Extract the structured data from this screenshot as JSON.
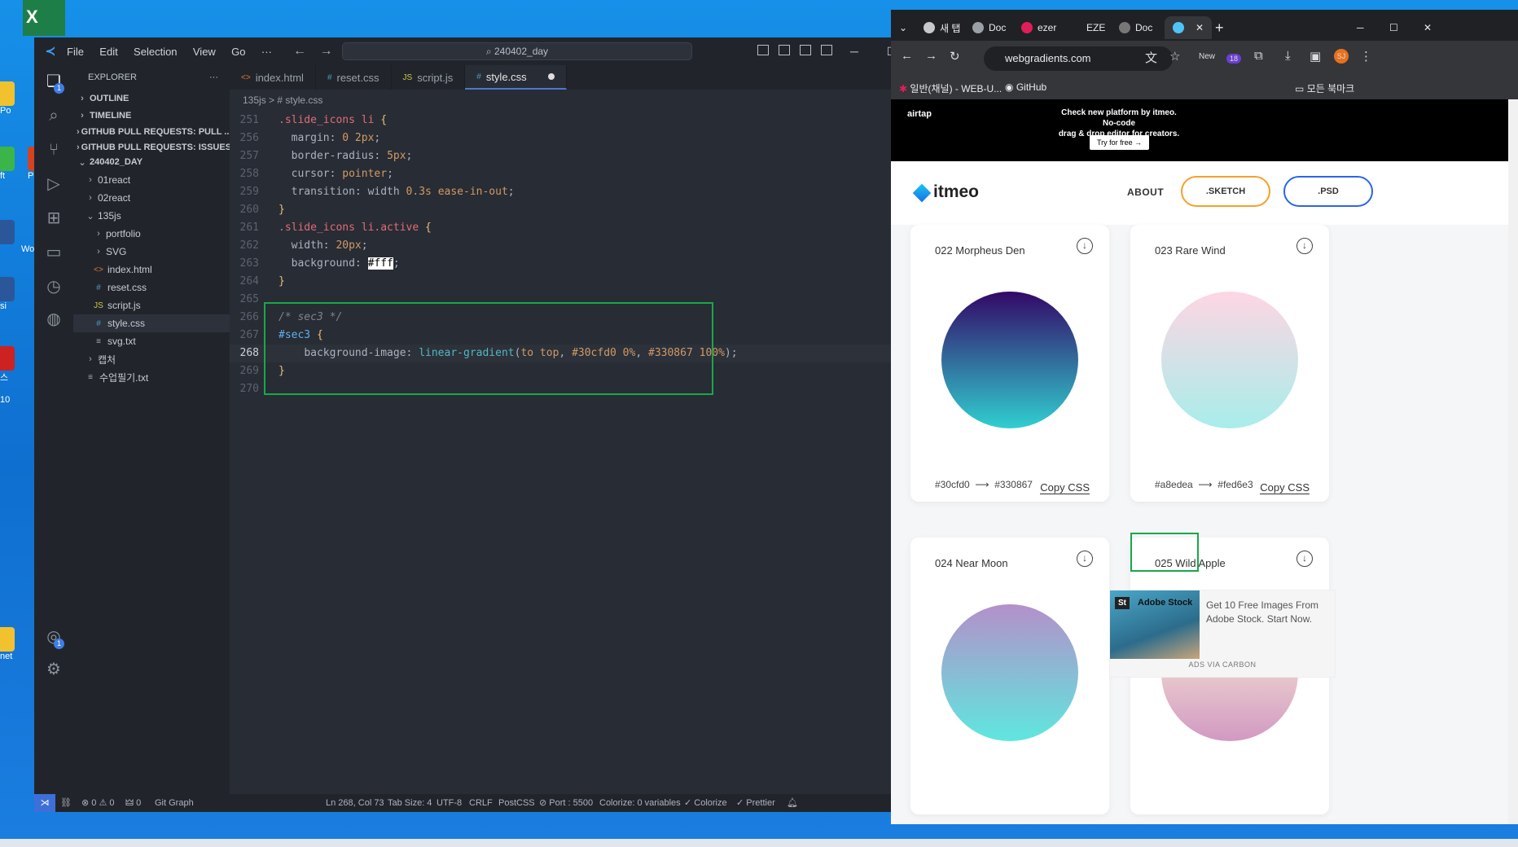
{
  "desktop": {
    "icon_labels": [
      "Po",
      "ft",
      "Po",
      "Wo",
      "si",
      "스",
      "10",
      "net"
    ]
  },
  "vscode": {
    "menu": [
      "File",
      "Edit",
      "Selection",
      "View",
      "Go",
      "···"
    ],
    "search_text": "240402_day",
    "explorer": {
      "title": "EXPLORER",
      "more": "···",
      "sections": [
        "OUTLINE",
        "TIMELINE",
        "GITHUB PULL REQUESTS: PULL ...",
        "GITHUB PULL REQUESTS: ISSUES",
        "240402_DAY"
      ],
      "tree": [
        {
          "label": "01react",
          "type": "folder",
          "indent": 1
        },
        {
          "label": "02react",
          "type": "folder",
          "indent": 1
        },
        {
          "label": "135js",
          "type": "folder-open",
          "indent": 1
        },
        {
          "label": "portfolio",
          "type": "folder",
          "indent": 2
        },
        {
          "label": "SVG",
          "type": "folder",
          "indent": 2
        },
        {
          "label": "index.html",
          "type": "html",
          "indent": 2
        },
        {
          "label": "reset.css",
          "type": "css",
          "indent": 2
        },
        {
          "label": "script.js",
          "type": "js",
          "indent": 2
        },
        {
          "label": "style.css",
          "type": "css",
          "indent": 2,
          "selected": true
        },
        {
          "label": "svg.txt",
          "type": "txt",
          "indent": 2
        },
        {
          "label": "캡처",
          "type": "folder",
          "indent": 1
        },
        {
          "label": "수업필기.txt",
          "type": "txt",
          "indent": 1
        }
      ]
    },
    "tabs": [
      {
        "label": "index.html",
        "icon": "<>",
        "color": "#e37933"
      },
      {
        "label": "reset.css",
        "icon": "#",
        "color": "#519aba"
      },
      {
        "label": "script.js",
        "icon": "JS",
        "color": "#cbcb41"
      },
      {
        "label": "style.css",
        "icon": "#",
        "color": "#519aba",
        "active": true
      }
    ],
    "breadcrumb": "135js > # style.css",
    "code_lines": [
      {
        "n": "251",
        "html": "<span class='c-sel'>.slide_icons li</span> <span class='c-brace'>{</span>"
      },
      {
        "n": "256",
        "html": "  <span class='c-prop'>margin:</span> <span class='c-num'>0 2px</span>;"
      },
      {
        "n": "257",
        "html": "  <span class='c-prop'>border-radius:</span> <span class='c-num'>5px</span>;"
      },
      {
        "n": "258",
        "html": "  <span class='c-prop'>cursor:</span> <span class='c-kw'>pointer</span>;"
      },
      {
        "n": "259",
        "html": "  <span class='c-prop'>transition:</span> <span class='c-prop'>width</span> <span class='c-num'>0.3s</span> <span class='c-kw'>ease-in-out</span>;"
      },
      {
        "n": "260",
        "html": "<span class='c-brace'>}</span>"
      },
      {
        "n": "261",
        "html": "<span class='c-sel'>.slide_icons li.active</span> <span class='c-brace'>{</span>"
      },
      {
        "n": "262",
        "html": "  <span class='c-prop'>width:</span> <span class='c-num'>20px</span>;"
      },
      {
        "n": "263",
        "html": "  <span class='c-prop'>background:</span> <span style='background:#fff;color:#000'>#fff</span>;"
      },
      {
        "n": "264",
        "html": "<span class='c-brace'>}</span>"
      },
      {
        "n": "265",
        "html": ""
      },
      {
        "n": "266",
        "html": "<span class='c-com'>/* sec3 */</span>"
      },
      {
        "n": "267",
        "html": "<span class='c-id'>#sec3</span> <span class='c-brace'>{</span>"
      },
      {
        "n": "268",
        "html": "    <span class='c-prop'>background-image:</span> <span class='c-fn'>linear-gradient</span>(<span class='c-kw'>to top</span>, <span class='c-num'>#30cfd0 0%</span>, <span class='c-num'>#330867 100%</span>);",
        "current": true
      },
      {
        "n": "269",
        "html": "<span class='c-brace'>}</span>"
      },
      {
        "n": "270",
        "html": ""
      }
    ],
    "status": {
      "errors": "⊗ 0 ⚠ 0",
      "ports": "🜲 0",
      "git_graph": "Git Graph",
      "position": "Ln 268, Col 73",
      "tab_size": "Tab Size: 4",
      "encoding": "UTF-8",
      "eol": "CRLF",
      "language": "PostCSS",
      "port": "⊘ Port : 5500",
      "colorize_vars": "Colorize: 0 variables",
      "colorize": "✓ Colorize",
      "prettier": "✓ Prettier"
    }
  },
  "chrome": {
    "tabs": [
      "새 탭",
      "Doc",
      "ezer",
      "EZE",
      "Doc"
    ],
    "url": "webgradients.com",
    "new_label": "New",
    "ext_badge": "18",
    "profile": "SJ",
    "bookmarks": [
      "일반(채널) - WEB-U...",
      "GitHub"
    ],
    "bookmarks_right": "모든 북마크",
    "ad": {
      "brand": "airtap",
      "headline": "Check new platform by itmeo. No-code",
      "headline2": "drag & drop editor for creators.",
      "cta": "Try for free →"
    },
    "site": {
      "logo": "itmeo",
      "about": "ABOUT",
      "sketch": ".SKETCH",
      "psd": ".PSD"
    },
    "gradients": [
      {
        "name": "022 Morpheus Den",
        "from": "#30cfd0",
        "to": "#330867",
        "copy": "Copy CSS"
      },
      {
        "name": "023 Rare Wind",
        "from": "#a8edea",
        "to": "#fed6e3",
        "copy": "Copy CSS"
      },
      {
        "name": "024 Near Moon",
        "from": "#5ee7df",
        "to": "#b490ca"
      },
      {
        "name": "025 Wild Apple",
        "from": "#d299c2",
        "to": "#fef9d7"
      }
    ],
    "carbon": {
      "brand": "Adobe Stock",
      "text": "Get 10 Free Images From Adobe Stock. Start Now.",
      "ads": "ADS VIA CARBON"
    }
  }
}
